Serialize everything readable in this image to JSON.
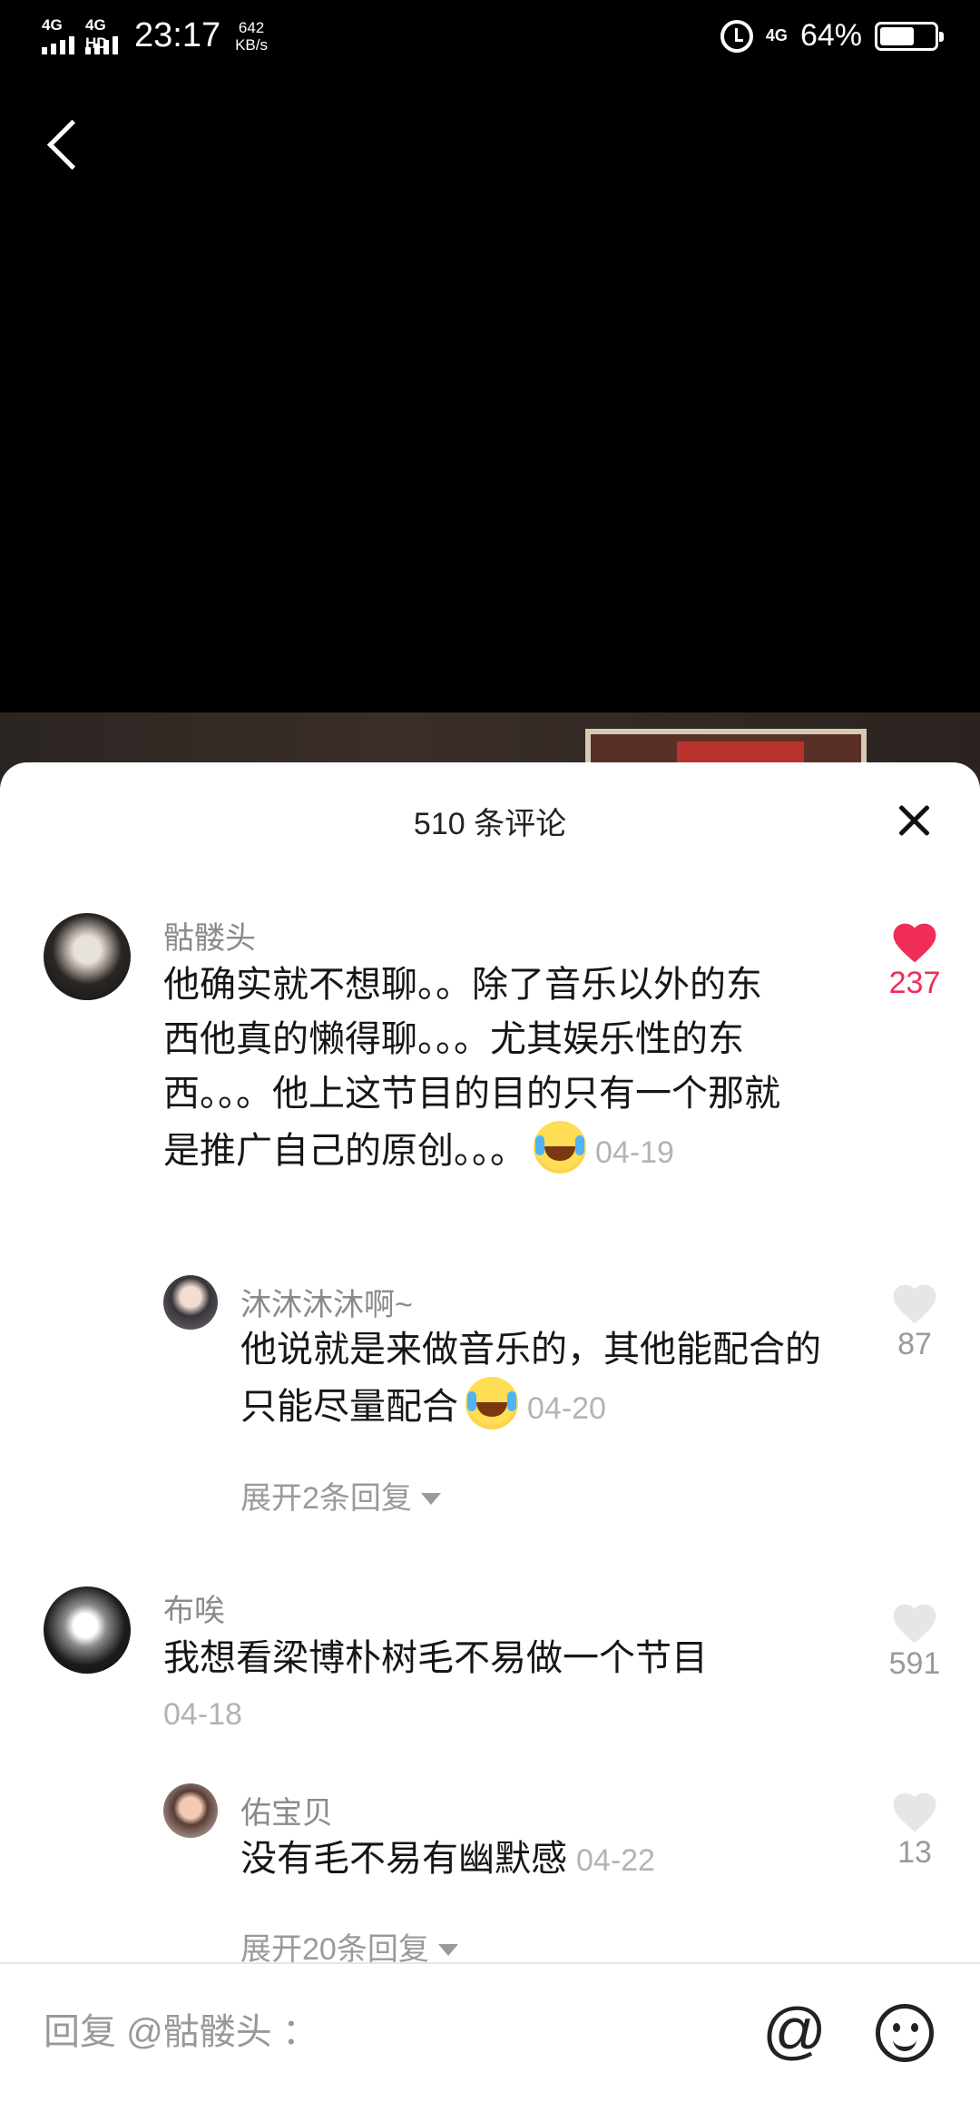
{
  "status_bar": {
    "sim1": "4G",
    "sim2": "4G HD",
    "time": "23:17",
    "speed_value": "642",
    "speed_unit": "KB/s",
    "network": "4G",
    "battery_text": "64%",
    "battery_level": 0.64
  },
  "sheet": {
    "title": "510 条评论"
  },
  "comments": [
    {
      "username": "骷髅头",
      "text": "他确实就不想聊。。除了音乐以外的东西他真的懒得聊。。。尤其娱乐性的东西。。。他上这节目的目的只有一个那就是推广自己的原创。。。",
      "date": "04-19",
      "likes": "237",
      "liked": true,
      "reply": {
        "username": "沐沐沐沐啊~",
        "text": "他说就是来做音乐的，其他能配合的只能尽量配合",
        "date": "04-20",
        "likes": "87"
      },
      "expand_label": "展开2条回复"
    },
    {
      "username": "布唉",
      "text": "我想看梁博朴树毛不易做一个节目",
      "date": "04-18",
      "likes": "591",
      "liked": false,
      "reply": {
        "username": "佑宝贝",
        "text": "没有毛不易有幽默感",
        "date": "04-22",
        "likes": "13"
      },
      "expand_label": "展开20条回复"
    }
  ],
  "reply_bar": {
    "placeholder": "回复 @骷髅头 ：",
    "at_symbol": "@"
  },
  "colors": {
    "liked": "#f02d56",
    "muted": "#9a9a9a"
  }
}
